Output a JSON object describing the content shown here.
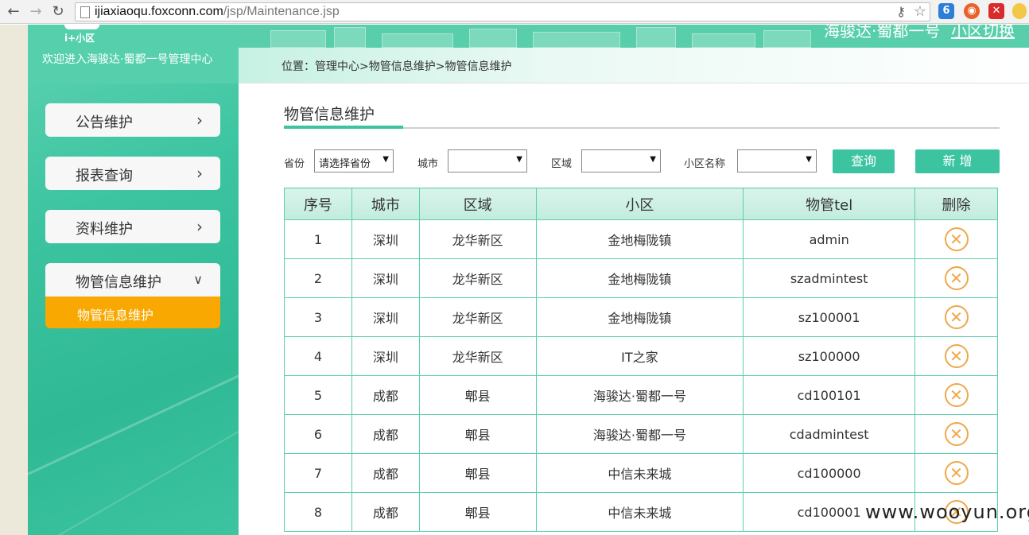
{
  "browser": {
    "url_host": "ijiaxiaoqu.foxconn.com",
    "url_path": "/jsp/Maintenance.jsp"
  },
  "sidebar": {
    "logo_text": "i+小区",
    "welcome": "欢迎进入海骏达·蜀都一号管理中心",
    "items": [
      {
        "label": "公告维护"
      },
      {
        "label": "报表查询"
      },
      {
        "label": "资料维护"
      },
      {
        "label": "物管信息维护"
      }
    ],
    "sub_item": "物管信息维护"
  },
  "header": {
    "community": "海骏达·蜀都一号",
    "switch_label": "小区切换"
  },
  "breadcrumb": "位置：管理中心>物管信息维护>物管信息维护",
  "section_title": "物管信息维护",
  "filters": {
    "province_label": "省份",
    "province_value": "请选择省份",
    "city_label": "城市",
    "district_label": "区域",
    "community_label": "小区名称",
    "query_label": "查询",
    "add_label": "新 增"
  },
  "table": {
    "headers": [
      "序号",
      "城市",
      "区域",
      "小区",
      "物管tel",
      "删除"
    ],
    "rows": [
      [
        "1",
        "深圳",
        "龙华新区",
        "金地梅陇镇",
        "admin"
      ],
      [
        "2",
        "深圳",
        "龙华新区",
        "金地梅陇镇",
        "szadmintest"
      ],
      [
        "3",
        "深圳",
        "龙华新区",
        "金地梅陇镇",
        "sz100001"
      ],
      [
        "4",
        "深圳",
        "龙华新区",
        "IT之家",
        "sz100000"
      ],
      [
        "5",
        "成都",
        "郫县",
        "海骏达·蜀都一号",
        "cd100101"
      ],
      [
        "6",
        "成都",
        "郫县",
        "海骏达·蜀都一号",
        "cdadmintest"
      ],
      [
        "7",
        "成都",
        "郫县",
        "中信未来城",
        "cd100000"
      ],
      [
        "8",
        "成都",
        "郫县",
        "中信未来城",
        "cd100001"
      ]
    ]
  },
  "watermark": "www.wooyun.org",
  "colors": {
    "accent": "#3cc4a0",
    "active_sub": "#f8a800",
    "delete": "#eea84a"
  }
}
